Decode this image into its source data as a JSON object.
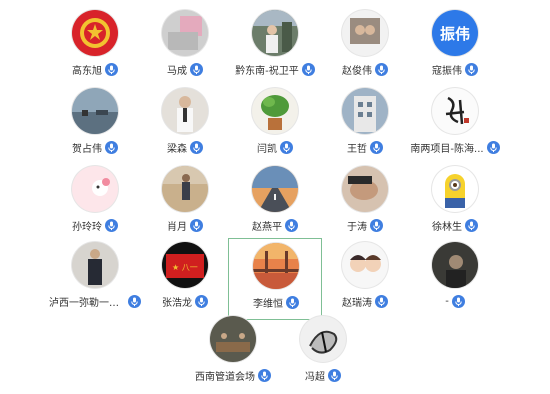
{
  "participants": [
    {
      "name": "高东旭",
      "avatar": "emblem-icon",
      "mic": "mic-icon"
    },
    {
      "name": "马成",
      "avatar": "blurred-photo-avatar",
      "mic": "mic-icon"
    },
    {
      "name": "黔东南-祝卫平",
      "avatar": "person-outdoor-avatar",
      "mic": "mic-icon"
    },
    {
      "name": "赵俊伟",
      "avatar": "couple-photo-avatar",
      "mic": "mic-icon"
    },
    {
      "name": "寇振伟",
      "avatar": "text-avatar",
      "avatar_text": "振伟",
      "mic": "mic-icon"
    },
    {
      "name": "贺占伟",
      "avatar": "lake-scenery-avatar",
      "mic": "mic-icon"
    },
    {
      "name": "梁森",
      "avatar": "person-indoor-avatar",
      "mic": "mic-icon"
    },
    {
      "name": "闫凯",
      "avatar": "potted-plant-avatar",
      "mic": "mic-icon"
    },
    {
      "name": "王哲",
      "avatar": "building-avatar",
      "mic": "mic-icon"
    },
    {
      "name": "南两项目-陈海...",
      "avatar": "calligraphy-avatar",
      "mic": "mic-icon"
    },
    {
      "name": "孙玲玲",
      "avatar": "cartoon-pink-avatar",
      "mic": "mic-icon"
    },
    {
      "name": "肖月",
      "avatar": "person-beach-avatar",
      "mic": "mic-icon"
    },
    {
      "name": "赵燕平",
      "avatar": "road-sunset-avatar",
      "mic": "mic-icon"
    },
    {
      "name": "于涛",
      "avatar": "sleeping-person-avatar",
      "mic": "mic-icon"
    },
    {
      "name": "徐林生",
      "avatar": "minion-avatar",
      "mic": "mic-icon"
    },
    {
      "name": "泸西一弥勒一开...",
      "avatar": "person-suit-avatar",
      "mic": "mic-icon"
    },
    {
      "name": "张浩龙",
      "avatar": "red-flag-avatar",
      "mic": "mic-icon"
    },
    {
      "name": "李维恒",
      "avatar": "bridge-sunset-avatar",
      "mic": "mic-icon",
      "selected": true
    },
    {
      "name": "赵瑞涛",
      "avatar": "cartoon-couple-avatar",
      "mic": "mic-icon"
    },
    {
      "name": "-",
      "avatar": "dark-person-avatar",
      "mic": "mic-icon"
    },
    {
      "name": "西南管道会场",
      "avatar": "meeting-room-avatar",
      "mic": "mic-icon"
    },
    {
      "name": "冯超",
      "avatar": "ink-sketch-avatar",
      "mic": "mic-icon"
    }
  ],
  "colors": {
    "mic": "#3f7ee0",
    "selected_border": "#7fbf95",
    "text_avatar_bg": "#2d79e8"
  }
}
